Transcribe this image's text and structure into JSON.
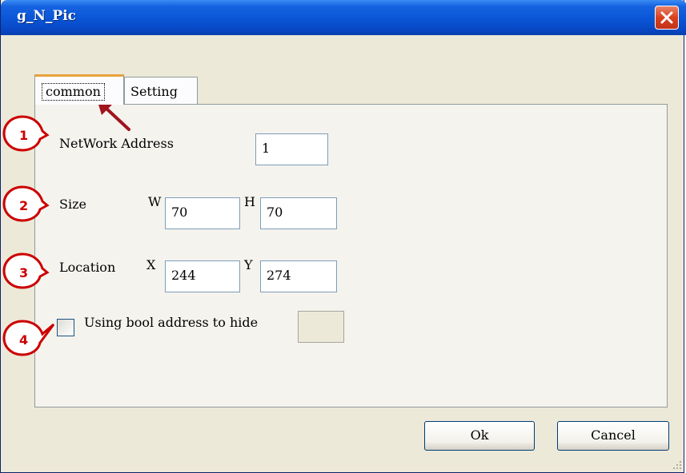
{
  "window": {
    "title": "g_N_Pic"
  },
  "tabs": [
    {
      "label": "common",
      "active": true
    },
    {
      "label": "Setting",
      "active": false
    }
  ],
  "form": {
    "network_address_label": "NetWork Address",
    "network_address_value": "1",
    "size_label": "Size",
    "width_label": "W",
    "width_value": "70",
    "height_label": "H",
    "height_value": "70",
    "location_label": "Location",
    "x_label": "X",
    "x_value": "244",
    "y_label": "Y",
    "y_value": "274",
    "hide_checkbox_label": "Using bool address to hide",
    "hide_checkbox_checked": false,
    "hide_address_value": ""
  },
  "buttons": {
    "ok_label": "Ok",
    "cancel_label": "Cancel"
  },
  "annotations": {
    "callouts": [
      "1",
      "2",
      "3",
      "4"
    ],
    "color": "#cc0000",
    "arrow_color": "#a0141e"
  }
}
